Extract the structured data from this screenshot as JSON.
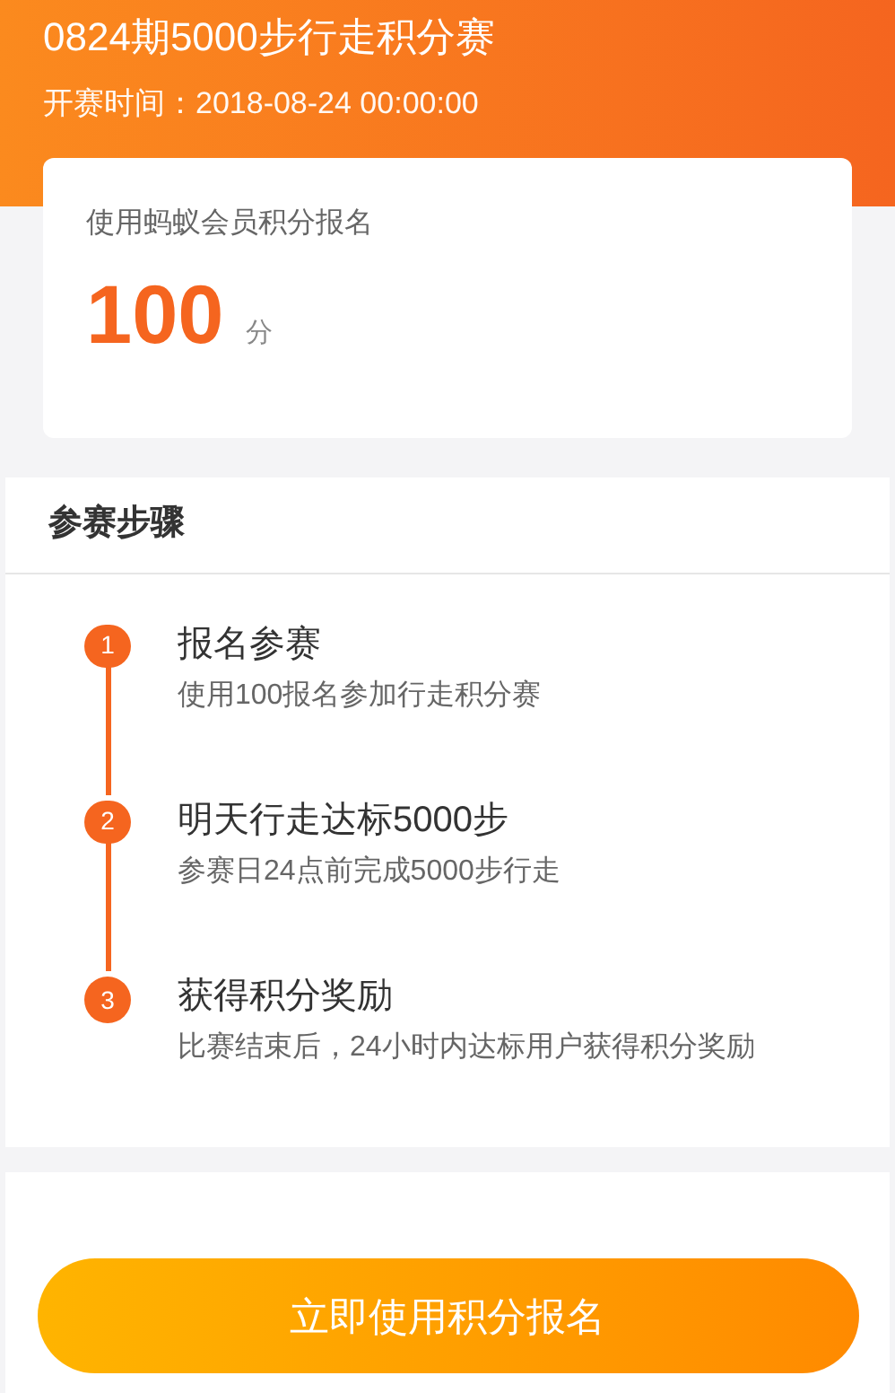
{
  "header": {
    "title": "0824期5000步行走积分赛",
    "start_time": "开赛时间：2018-08-24 00:00:00"
  },
  "entry_card": {
    "label": "使用蚂蚁会员积分报名",
    "points": "100",
    "unit": "分"
  },
  "steps_section": {
    "title": "参赛步骤",
    "steps": [
      {
        "number": "1",
        "title": "报名参赛",
        "description": "使用100报名参加行走积分赛"
      },
      {
        "number": "2",
        "title": "明天行走达标5000步",
        "description": "参赛日24点前完成5000步行走"
      },
      {
        "number": "3",
        "title": "获得积分奖励",
        "description": "比赛结束后，24小时内达标用户获得积分奖励"
      }
    ]
  },
  "signup_button": {
    "label": "立即使用积分报名"
  }
}
